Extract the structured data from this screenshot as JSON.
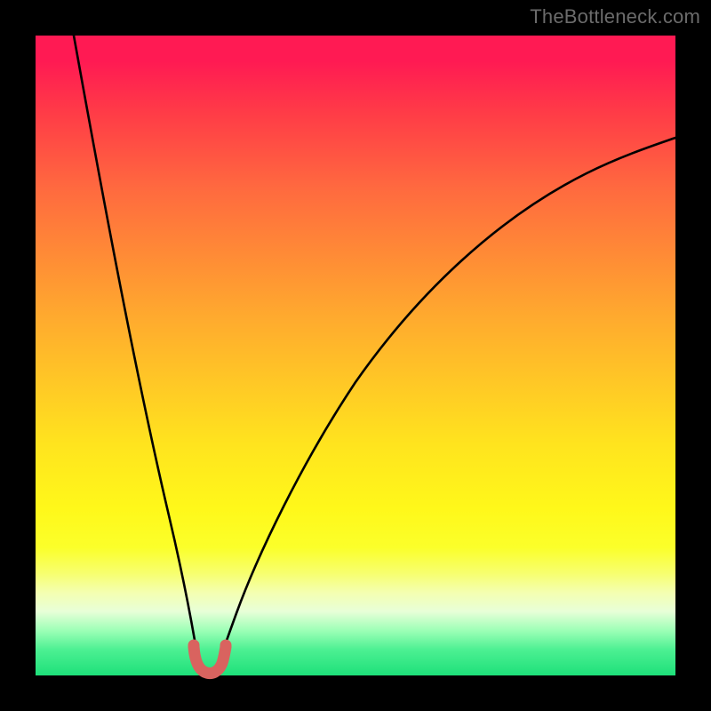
{
  "watermark": "TheBottleneck.com",
  "colors": {
    "frame": "#000000",
    "curve": "#000000",
    "bump_fill": "#d9635f",
    "bump_stroke": "#d9635f",
    "gradient_stops": [
      "#ff1a53",
      "#ff3b47",
      "#ff6a3f",
      "#ff8a36",
      "#ffaa2e",
      "#ffc726",
      "#ffe41e",
      "#fff81a",
      "#f7ff6e",
      "#e8ffd8",
      "#4cf092",
      "#1ee07a"
    ]
  },
  "chart_data": {
    "type": "line",
    "title": "",
    "xlabel": "",
    "ylabel": "",
    "xlim": [
      0,
      100
    ],
    "ylim": [
      0,
      100
    ],
    "grid": false,
    "legend": false,
    "series": [
      {
        "name": "left-branch",
        "x": [
          6,
          10,
          14,
          18,
          20,
          22,
          23.5,
          24.5,
          25.3
        ],
        "y": [
          100,
          77,
          53,
          30,
          18.5,
          9.5,
          4.5,
          1.8,
          0.8
        ]
      },
      {
        "name": "right-branch",
        "x": [
          28.5,
          29.5,
          31,
          34,
          38,
          44,
          52,
          62,
          74,
          88,
          100
        ],
        "y": [
          0.8,
          1.8,
          4.5,
          11,
          20,
          32,
          45,
          58,
          69,
          78.5,
          84
        ]
      }
    ],
    "annotations": [
      {
        "name": "minimum-bump",
        "shape": "u",
        "x_range": [
          24.5,
          29.5
        ],
        "y_range": [
          0.5,
          4.2
        ],
        "color": "#d9635f"
      }
    ]
  }
}
